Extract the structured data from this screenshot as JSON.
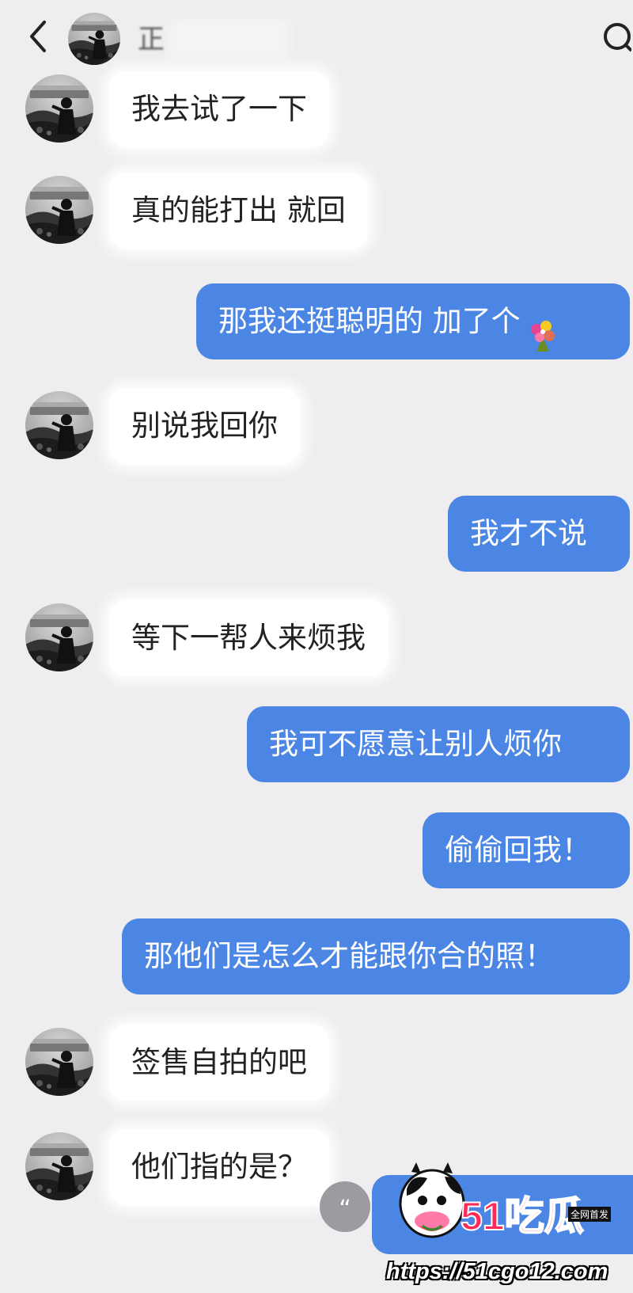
{
  "header": {
    "title": "正",
    "back_icon": "chevron-left-icon",
    "search_icon": "search-icon"
  },
  "messages": [
    {
      "side": "in",
      "text": "我去试了一下"
    },
    {
      "side": "in",
      "text": "真的能打出 就回"
    },
    {
      "side": "out",
      "text": "那我还挺聪明的 加了个",
      "emoji": "flower-bouquet-icon"
    },
    {
      "side": "in",
      "text": "别说我回你"
    },
    {
      "side": "out",
      "text": "我才不说"
    },
    {
      "side": "in",
      "text": "等下一帮人来烦我"
    },
    {
      "side": "out",
      "text": "我可不愿意让别人烦你"
    },
    {
      "side": "out",
      "text": "偷偷回我！"
    },
    {
      "side": "out",
      "text": "那他们是怎么才能跟你合的照！"
    },
    {
      "side": "in",
      "text": "签售自拍的吧"
    },
    {
      "side": "in",
      "text": "他们指的是？"
    }
  ],
  "quote_button": {
    "label": "“",
    "icon": "quote-icon"
  },
  "watermark": {
    "logo": "51吃瓜",
    "badge": "全网首发",
    "url": "https://51cgo12.com"
  },
  "colors": {
    "background": "#eeeef0",
    "outgoing_bubble": "#4b86e4",
    "incoming_bubble": "#ffffff"
  }
}
